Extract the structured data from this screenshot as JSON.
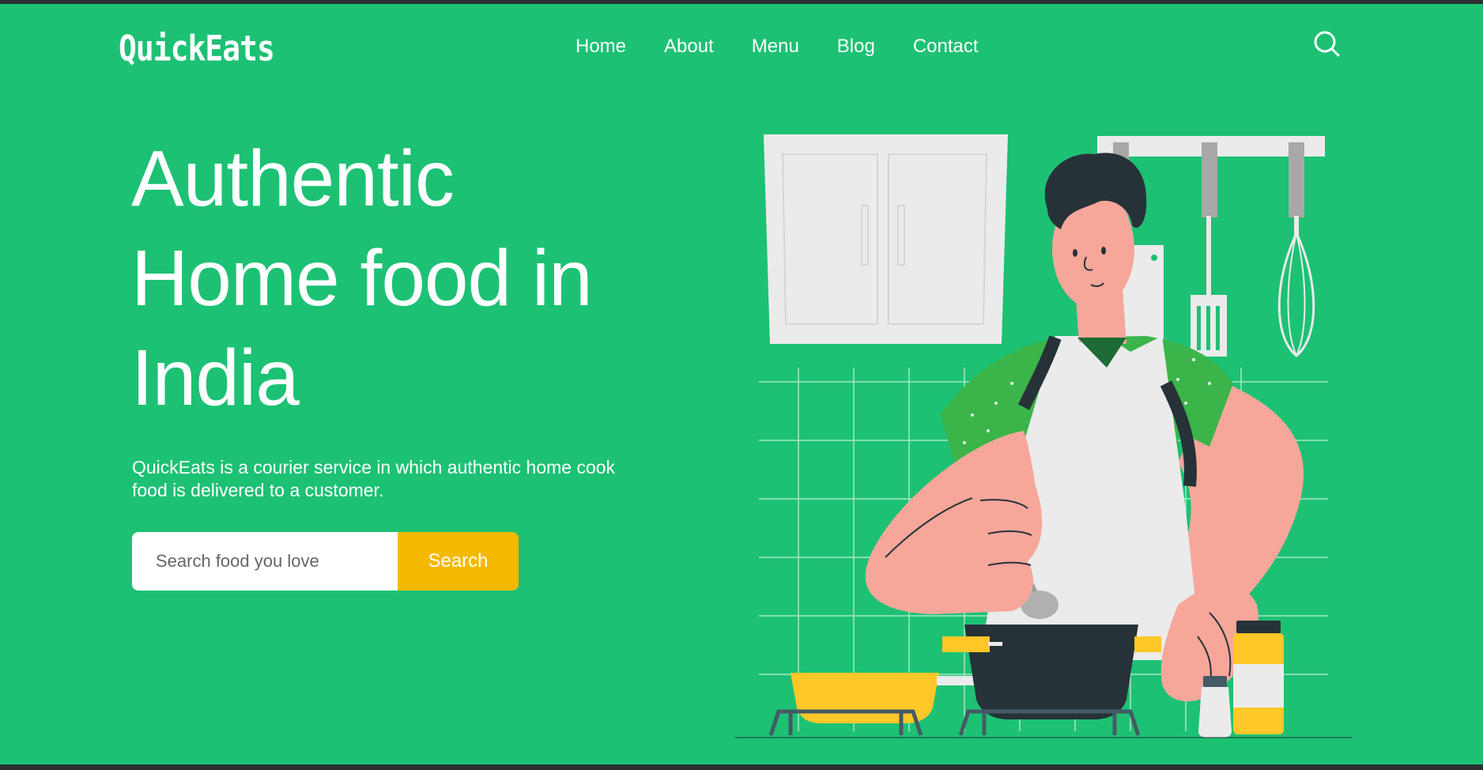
{
  "header": {
    "logo": "QuickEats",
    "nav": [
      {
        "label": "Home"
      },
      {
        "label": "About"
      },
      {
        "label": "Menu"
      },
      {
        "label": "Blog"
      },
      {
        "label": "Contact"
      }
    ],
    "search_icon": "search-icon"
  },
  "hero": {
    "headline_lines": [
      "Authentic",
      "Home food in",
      "India"
    ],
    "description": "QuickEats is a courier service in which authentic home cook food is delivered to a customer.",
    "search": {
      "placeholder": "Search food you love",
      "value": "",
      "button_label": "Search"
    },
    "illustration": "chef-cooking-illustration"
  },
  "colors": {
    "background": "#1dc174",
    "accent": "#f5b900",
    "text": "#ffffff"
  }
}
